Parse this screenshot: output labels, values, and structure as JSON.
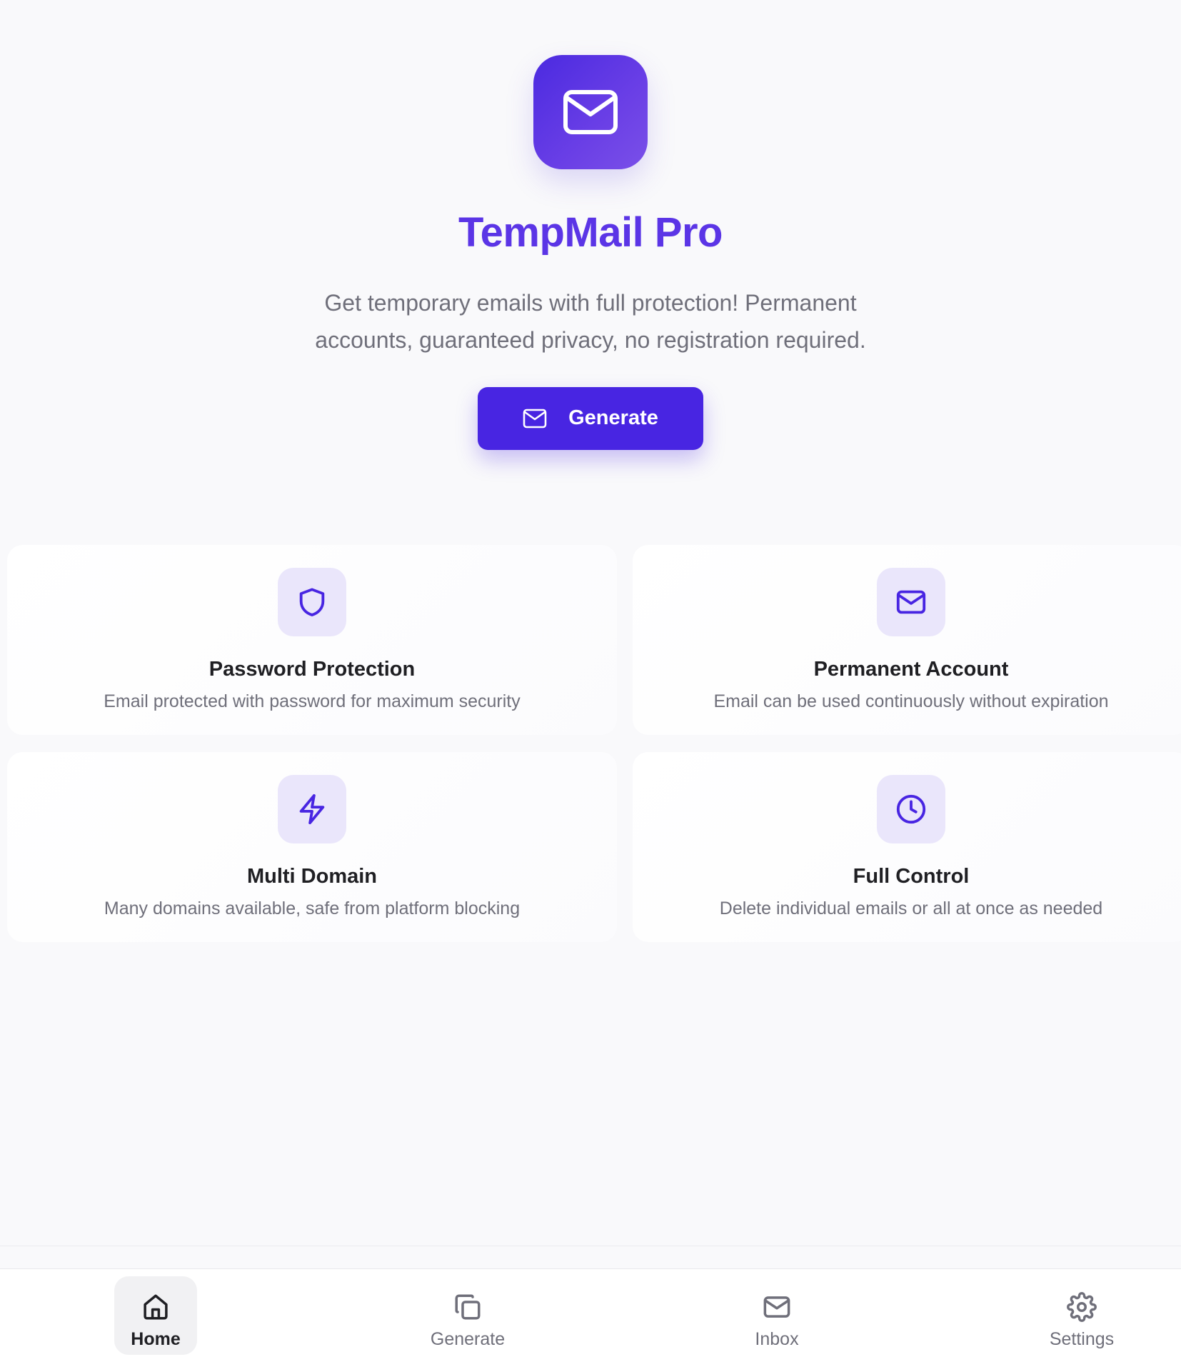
{
  "app": {
    "title": "TempMail Pro",
    "tagline": "Get temporary emails with full protection! Permanent accounts, guaranteed privacy, no registration required.",
    "logo_icon": "mail-icon",
    "brand_color": "#5b35e6",
    "button_color": "#4825e2"
  },
  "hero": {
    "generate_label": "Generate",
    "generate_icon": "mail-icon"
  },
  "features": [
    {
      "icon": "shield-icon",
      "title": "Password Protection",
      "description": "Email protected with password for maximum security"
    },
    {
      "icon": "mail-icon",
      "title": "Permanent Account",
      "description": "Email can be used continuously without expiration"
    },
    {
      "icon": "lightning-icon",
      "title": "Multi Domain",
      "description": "Many domains available, safe from platform blocking"
    },
    {
      "icon": "clock-icon",
      "title": "Full Control",
      "description": "Delete individual emails or all at once as needed"
    }
  ],
  "nav": {
    "items": [
      {
        "label": "Home",
        "icon": "home-icon",
        "active": true
      },
      {
        "label": "Generate",
        "icon": "copy-icon",
        "active": false
      },
      {
        "label": "Inbox",
        "icon": "mail-icon",
        "active": false
      },
      {
        "label": "Settings",
        "icon": "gear-icon",
        "active": false
      }
    ]
  }
}
